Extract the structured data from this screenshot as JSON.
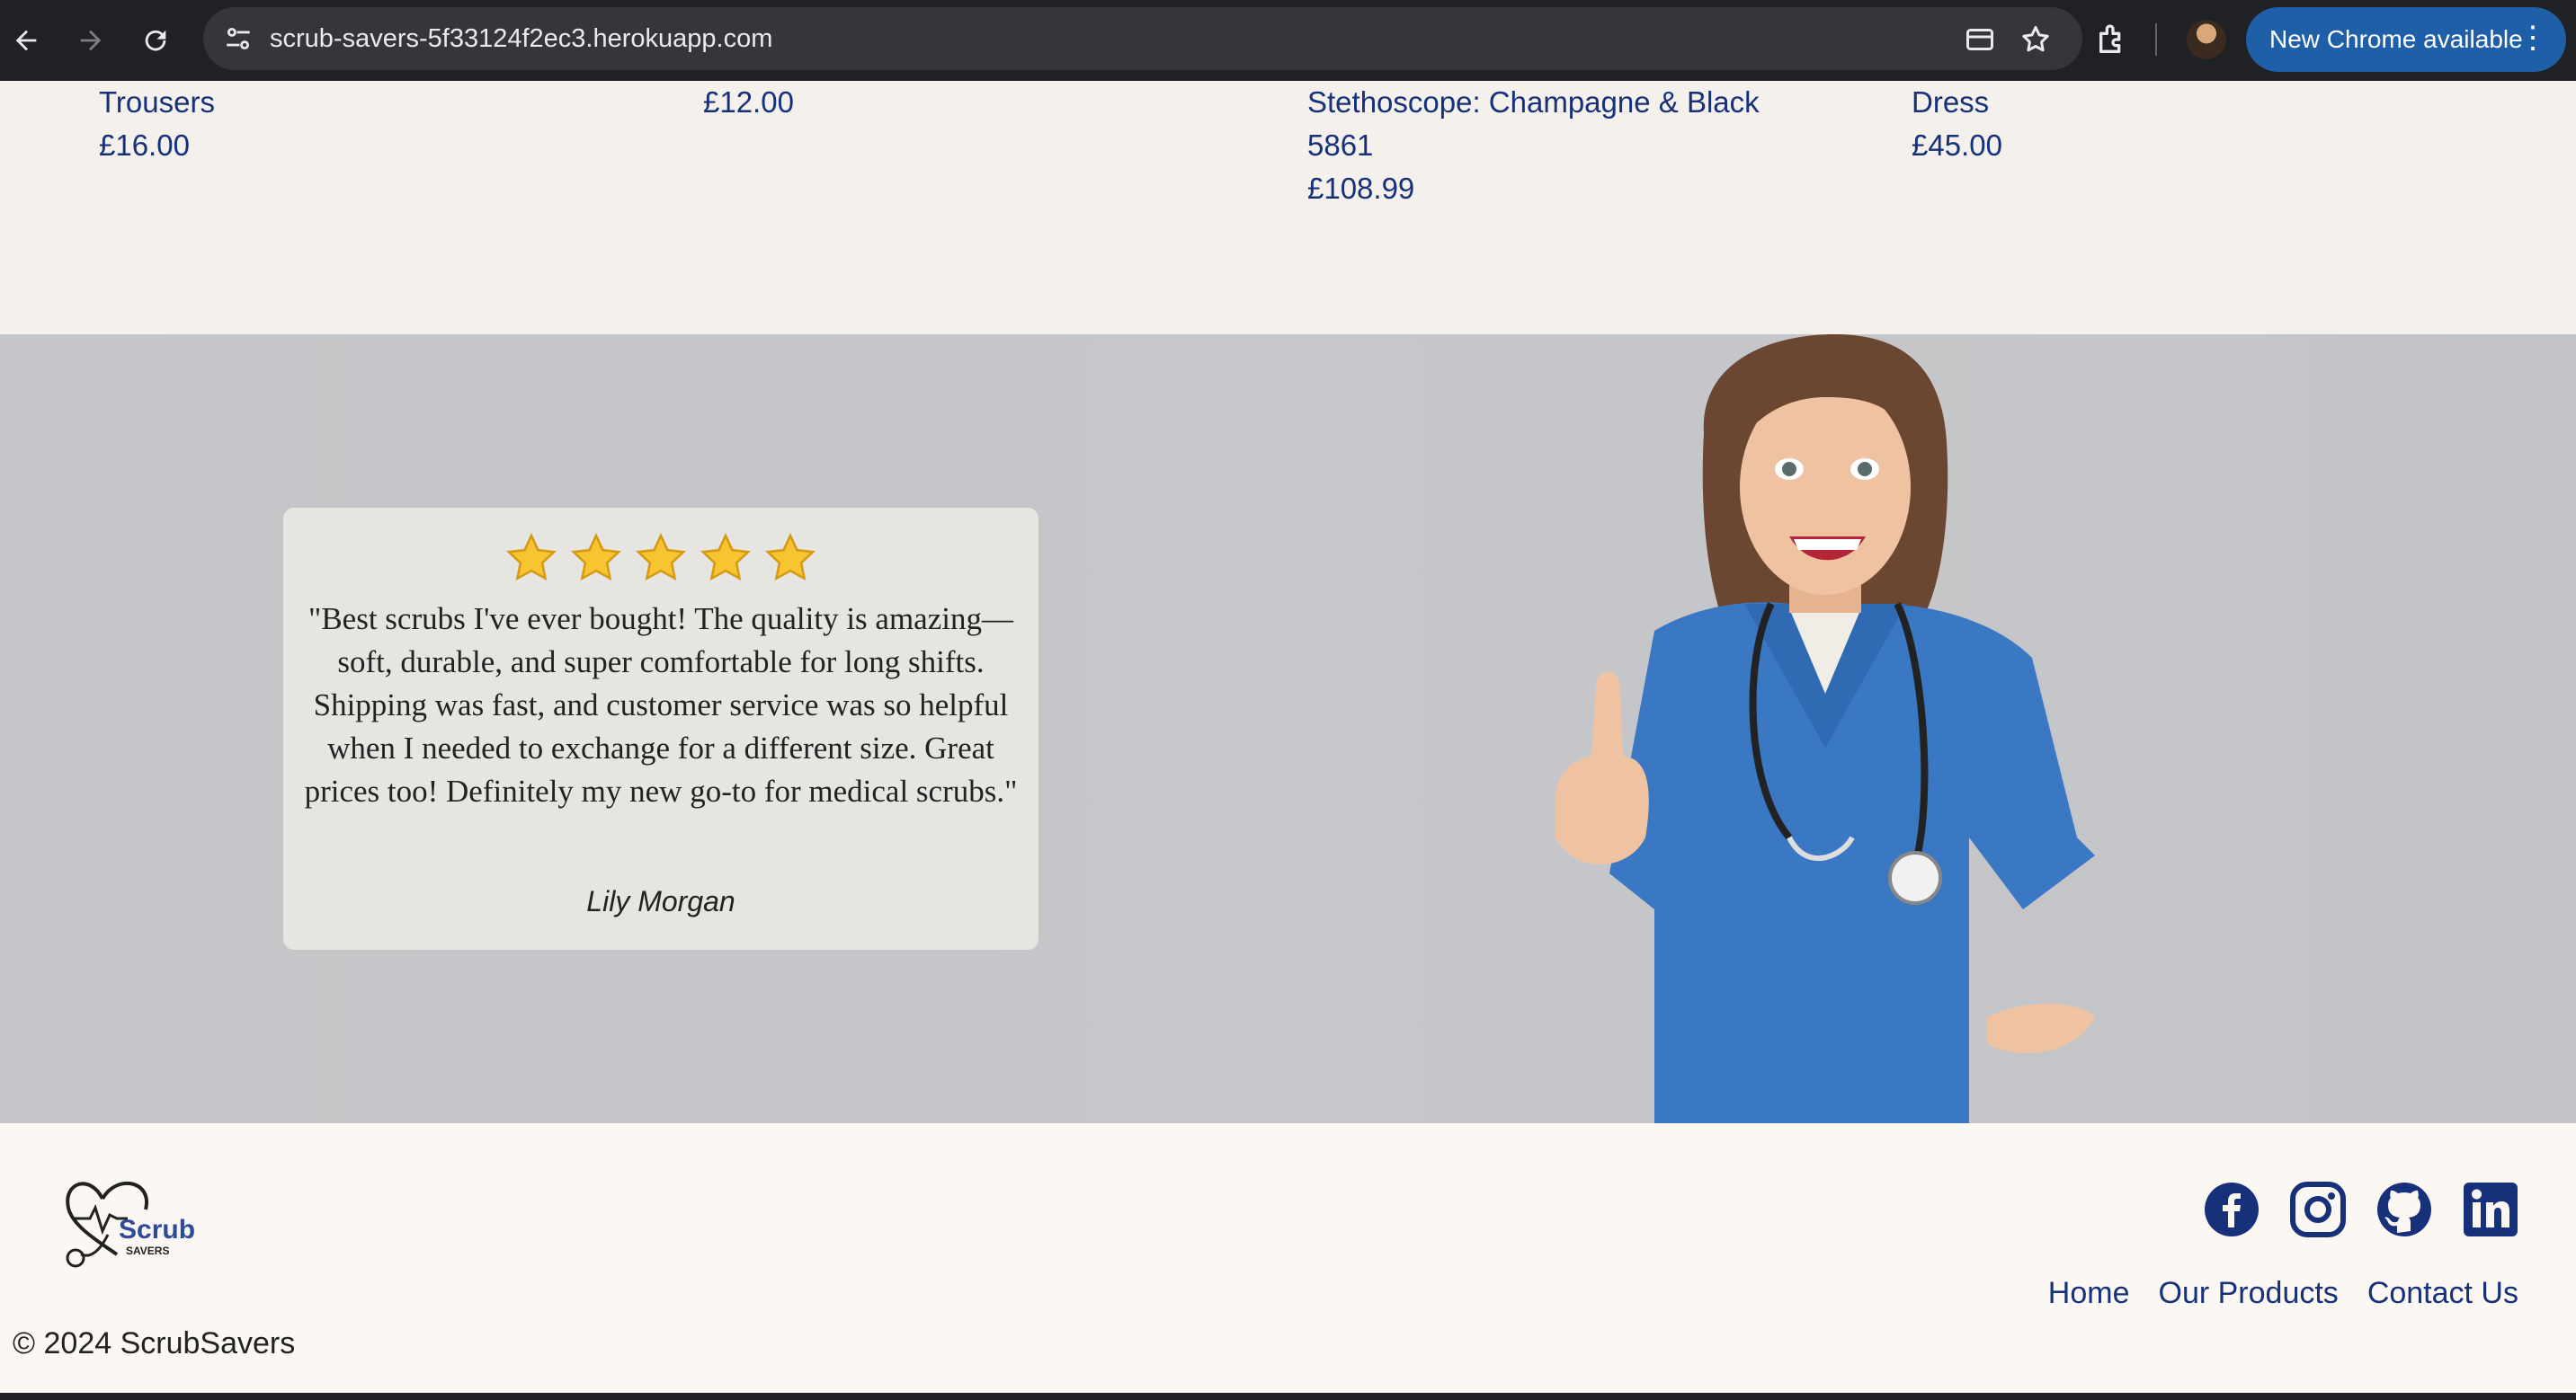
{
  "browser": {
    "url": "scrub-savers-5f33124f2ec3.herokuapp.com",
    "update_label": "New Chrome available",
    "menu_glyph": "⋮"
  },
  "products": [
    {
      "name_lines": [
        "Trousers"
      ],
      "price": "£16.00"
    },
    {
      "name_lines": [],
      "price": "£12.00"
    },
    {
      "name_lines": [
        "Stethoscope: Champagne & Black",
        "5861"
      ],
      "price": "£108.99"
    },
    {
      "name_lines": [
        "Dress"
      ],
      "price": "£45.00"
    }
  ],
  "testimonial": {
    "rating": 5,
    "text": "\"Best scrubs I've ever bought! The quality is amazing—soft, durable, and super comfortable for long shifts. Shipping was fast, and customer service was so helpful when I needed to exchange for a different size. Great prices too! Definitely my new go-to for medical scrubs.\"",
    "author": "Lily Morgan"
  },
  "footer": {
    "logo_word": "Scrub",
    "logo_sub": "SAVERS",
    "socials": [
      "facebook-icon",
      "instagram-icon",
      "github-icon",
      "linkedin-icon"
    ],
    "links": [
      "Home",
      "Our Products",
      "Contact Us"
    ],
    "copyright": "© 2024 ScrubSavers"
  },
  "colors": {
    "brand_navy": "#17307a",
    "chrome_dark": "#202124",
    "update_blue": "#1e5fa8",
    "scrub_blue": "#3a78c4"
  }
}
